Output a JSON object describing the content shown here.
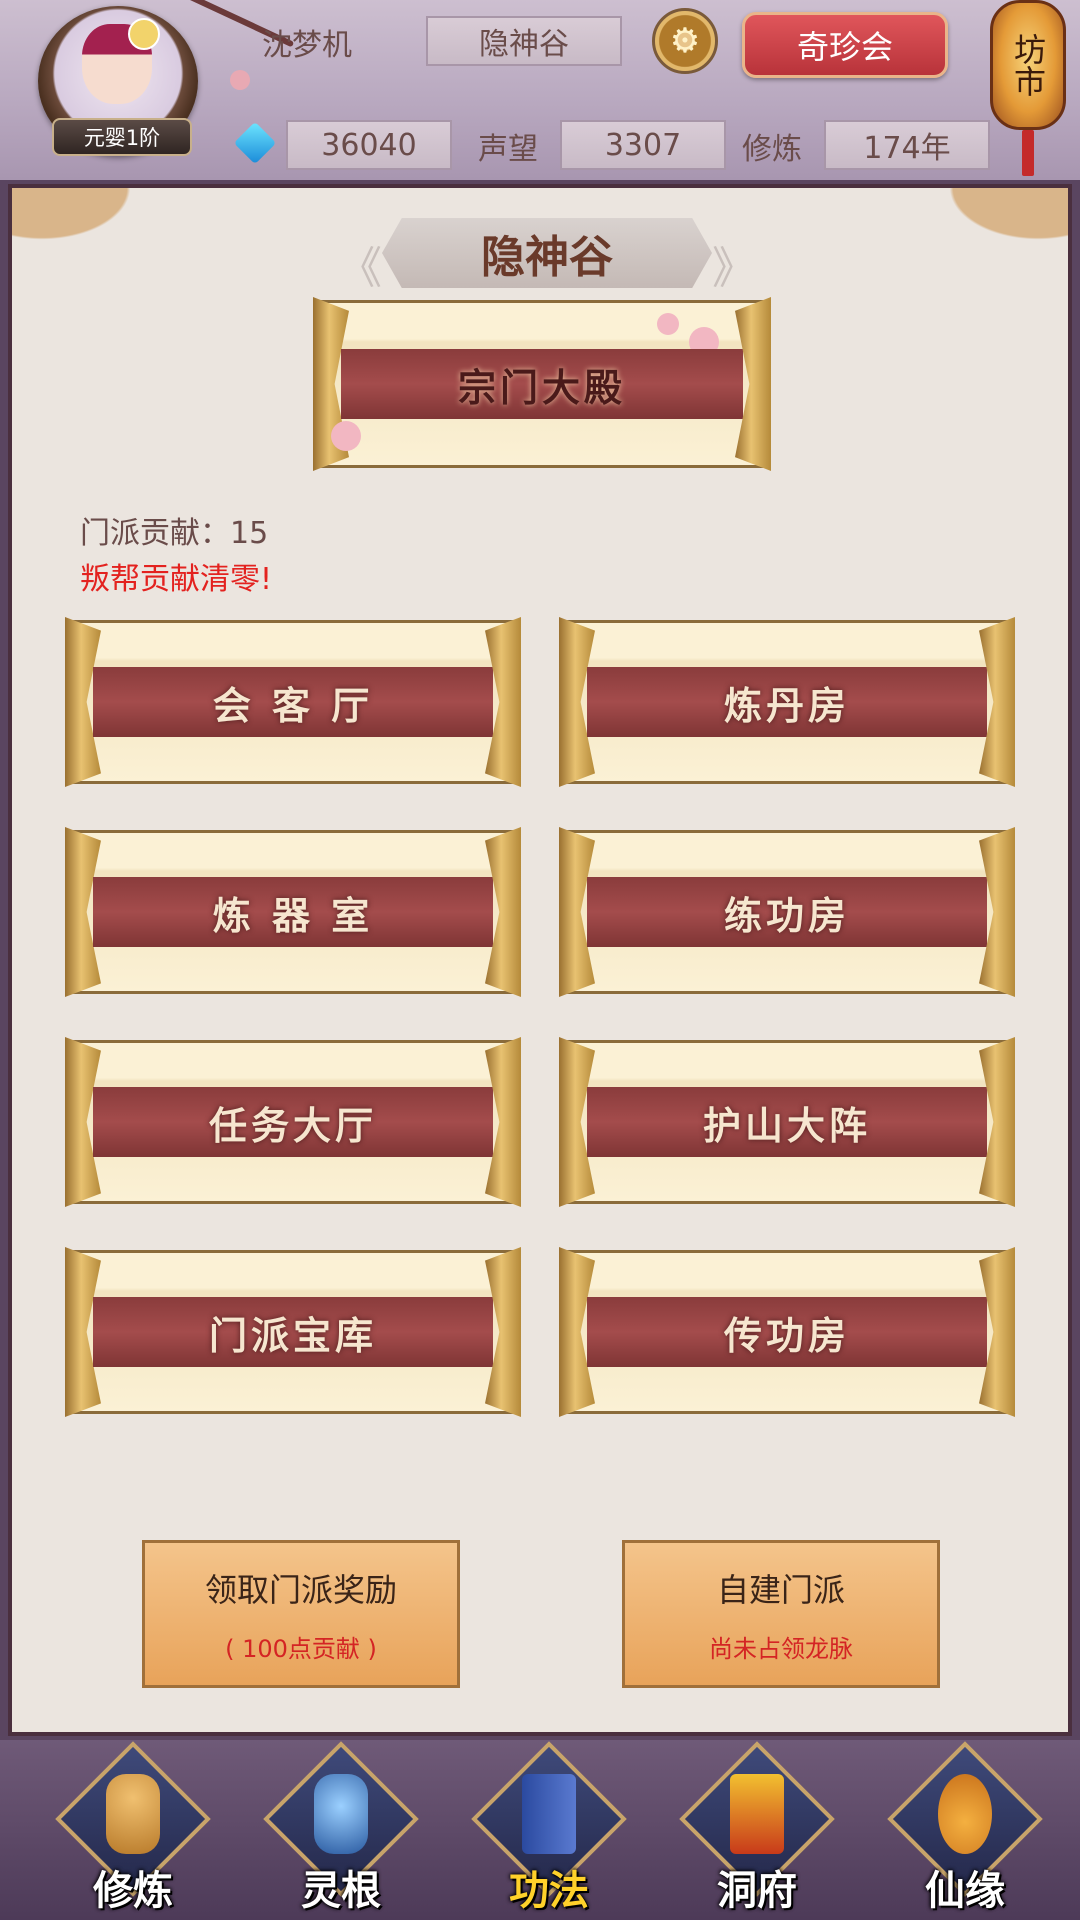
{
  "header": {
    "player_name": "沈梦机",
    "rank": "元婴1阶",
    "location": "隐神谷",
    "treasure_button": "奇珍会",
    "lantern_text": "坊市",
    "gems": "36040",
    "reputation_label": "声望",
    "reputation": "3307",
    "cultivation_label": "修炼",
    "cultivation": "174年"
  },
  "panel": {
    "title": "隐神谷",
    "main_hall": "宗门大殿",
    "contribution": "门派贡献：15",
    "warning": "叛帮贡献清零!",
    "buildings": [
      "会 客 厅",
      "炼丹房",
      "炼 器 室",
      "练功房",
      "任务大厅",
      "护山大阵",
      "门派宝库",
      "传功房"
    ],
    "reward_button": {
      "title": "领取门派奖励",
      "subtitle": "( 100点贡献 )"
    },
    "create_button": {
      "title": "自建门派",
      "subtitle": "尚未占领龙脉"
    }
  },
  "nav": {
    "items": [
      {
        "label": "修炼",
        "icon": "monk-icon",
        "active": false
      },
      {
        "label": "灵根",
        "icon": "sword-icon",
        "active": false
      },
      {
        "label": "功法",
        "icon": "book-icon",
        "active": true
      },
      {
        "label": "洞府",
        "icon": "pagoda-icon",
        "active": false
      },
      {
        "label": "仙缘",
        "icon": "gourd-icon",
        "active": false
      }
    ]
  },
  "colors": {
    "accent_red": "#e3221f",
    "ribbon": "#8a3c3c",
    "active_nav": "#ffd12a"
  }
}
